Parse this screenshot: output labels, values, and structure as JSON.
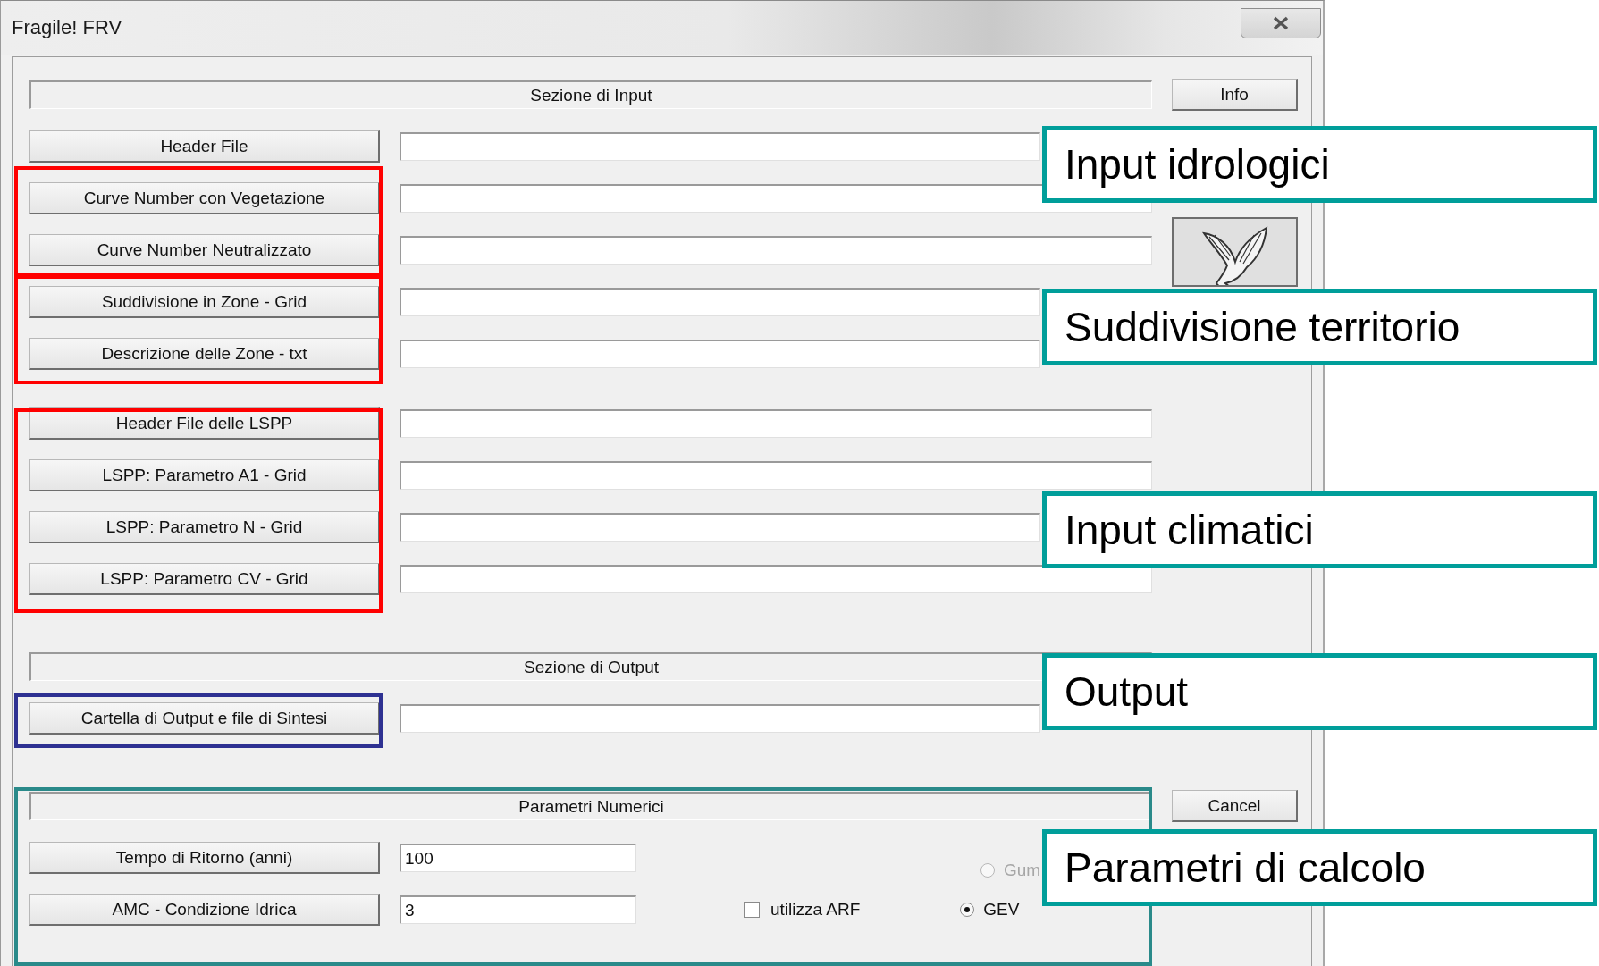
{
  "window": {
    "title": "Fragile! FRV"
  },
  "input_section": {
    "title": "Sezione di Input",
    "groups": [
      {
        "files": [
          {
            "label": "Header File"
          },
          {
            "label": "Curve Number con Vegetazione"
          },
          {
            "label": "Curve Number Neutralizzato"
          },
          {
            "label": "Suddivisione in Zone - Grid"
          },
          {
            "label": "Descrizione delle Zone - txt"
          }
        ]
      },
      {
        "files": [
          {
            "label": "Header File delle LSPP"
          },
          {
            "label": "LSPP: Parametro A1 - Grid"
          },
          {
            "label": "LSPP: Parametro N - Grid"
          },
          {
            "label": "LSPP: Parametro CV - Grid"
          }
        ]
      }
    ]
  },
  "output_section": {
    "title": "Sezione di Output",
    "files": [
      {
        "label": "Cartella di Output e file di Sintesi"
      }
    ]
  },
  "numeric_section": {
    "title": "Parametri Numerici",
    "params": [
      {
        "label": "Tempo di Ritorno (anni)",
        "value": "100"
      },
      {
        "label": "AMC - Condizione Idrica",
        "value": "3"
      }
    ],
    "use_arf": {
      "label": "utilizza ARF",
      "checked": false
    },
    "distribution": [
      {
        "label": "Gum",
        "selected": false,
        "disabled": true
      },
      {
        "label": "GEV",
        "selected": true,
        "disabled": false
      }
    ]
  },
  "side_buttons": {
    "info": "Info",
    "cancel": "Cancel"
  },
  "group_frames": [
    {
      "color": "#ff0000"
    },
    {
      "color": "#ff0000"
    },
    {
      "color": "#ff0000"
    },
    {
      "color": "#2e3192"
    },
    {
      "color": "#2a8a8a"
    }
  ],
  "annotations": [
    {
      "text": "Input idrologici"
    },
    {
      "text": "Suddivisione territorio"
    },
    {
      "text": "Input climatici"
    },
    {
      "text": "Output"
    },
    {
      "text": "Parametri di calcolo"
    }
  ]
}
